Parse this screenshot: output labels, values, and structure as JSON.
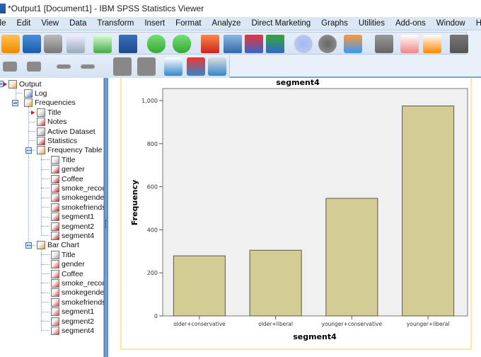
{
  "window": {
    "title": "*Output1 [Document1] - IBM SPSS Statistics Viewer"
  },
  "menu": [
    "ile",
    "Edit",
    "View",
    "Data",
    "Transform",
    "Insert",
    "Format",
    "Analyze",
    "Direct Marketing",
    "Graphs",
    "Utilities",
    "Add-ons",
    "Window",
    "Help"
  ],
  "toolbar1_icons": [
    "open-icon",
    "save-icon",
    "print-icon",
    "print-preview-icon",
    "export-icon",
    "recall-dialog-icon",
    "undo-icon",
    "redo-icon",
    "goto-case-icon",
    "goto-variable-icon",
    "insert-cases-icon",
    "insert-variables-icon",
    "split-file-icon",
    "select-cases-icon",
    "value-labels-icon",
    "use-variable-sets-icon",
    "script-icon",
    "designate-window-icon",
    "run-script-icon",
    "stop-icon"
  ],
  "toolbar2_icons": [
    "back-icon",
    "forward-icon",
    "expand-icon",
    "collapse-icon",
    "show-icon",
    "hide-icon",
    "insert-heading-icon",
    "insert-title-icon",
    "insert-text-icon"
  ],
  "tree": {
    "root": "Output",
    "log": "Log",
    "frequencies": "Frequencies",
    "freq_children": [
      "Title",
      "Notes",
      "Active Dataset",
      "Statistics"
    ],
    "frequency_table": "Frequency Table",
    "ft_children": [
      "Title",
      "gender",
      "Coffee",
      "smoke_recoc",
      "smokegende",
      "smokefriends",
      "segment1",
      "segment2",
      "segment4"
    ],
    "bar_chart": "Bar Chart",
    "bc_children": [
      "Title",
      "gender",
      "Coffee",
      "smoke_recoc",
      "smokegende",
      "smokefriends",
      "segment1",
      "segment2",
      "segment4"
    ]
  },
  "chart_data": {
    "type": "bar",
    "title": "segment4",
    "xlabel": "segment4",
    "ylabel": "Frequency",
    "categories": [
      "older+conservative",
      "older+liberal",
      "younger+conservative",
      "younger+liberal"
    ],
    "values": [
      279,
      305,
      546,
      975
    ],
    "ylim": [
      0,
      1060
    ],
    "yticks": [
      0,
      200,
      400,
      600,
      800,
      1000
    ],
    "ytick_labels": [
      "0",
      "200",
      "400",
      "600",
      "800",
      "1,000"
    ],
    "grid": false,
    "legend": "none",
    "colors": {
      "bar": "#d3cd95",
      "bar_border": "#5a5a4a",
      "plot_bg": "#f0f0f0"
    }
  }
}
